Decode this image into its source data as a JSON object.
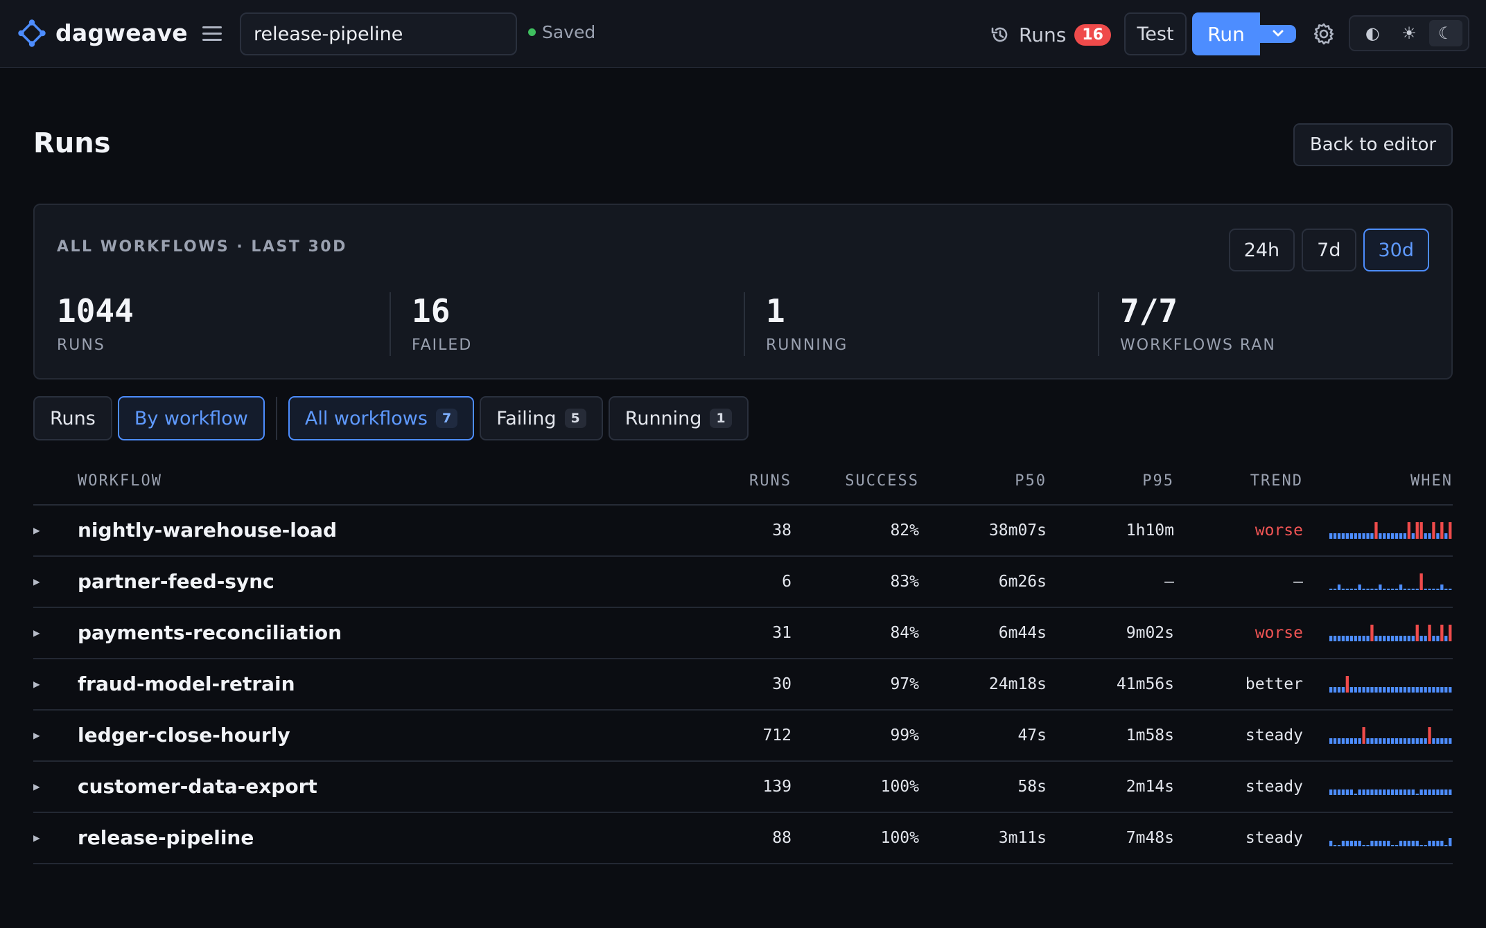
{
  "app": {
    "brand": "dagweave"
  },
  "header": {
    "workflow_name": "release-pipeline",
    "saved_label": "Saved",
    "runs_label": "Runs",
    "runs_count": "16",
    "test_label": "Test",
    "run_label": "Run",
    "theme_icons": [
      "contrast-icon",
      "sun-icon",
      "moon-icon"
    ],
    "theme_symbols": [
      "◐",
      "☀",
      "☾"
    ]
  },
  "page": {
    "title": "Runs",
    "back_label": "Back to editor"
  },
  "summary": {
    "label": "ALL WORKFLOWS · LAST 30D",
    "ranges": [
      "24h",
      "7d",
      "30d"
    ],
    "active_range": "30d",
    "stats": [
      {
        "value": "1044",
        "label": "RUNS"
      },
      {
        "value": "16",
        "label": "FAILED"
      },
      {
        "value": "1",
        "label": "RUNNING"
      },
      {
        "value": "7/7",
        "label": "WORKFLOWS RAN"
      }
    ]
  },
  "view_toggle": {
    "runs": "Runs",
    "by_workflow": "By workflow",
    "active": "by_workflow"
  },
  "filters": [
    {
      "label": "All workflows",
      "count": "7",
      "active": true
    },
    {
      "label": "Failing",
      "count": "5",
      "active": false
    },
    {
      "label": "Running",
      "count": "1",
      "active": false
    }
  ],
  "table": {
    "columns": [
      "WORKFLOW",
      "RUNS",
      "SUCCESS",
      "P50",
      "P95",
      "TREND",
      "WHEN"
    ],
    "rows": [
      {
        "name": "nightly-warehouse-load",
        "runs": "38",
        "success": "82%",
        "p50": "38m07s",
        "p95": "1h10m",
        "trend": "worse",
        "spark": [
          0,
          0,
          0,
          0,
          0,
          0,
          0,
          0,
          0,
          0,
          0,
          1,
          0,
          0,
          0,
          0,
          0,
          0,
          0,
          1,
          0,
          1,
          1,
          0,
          0,
          1,
          0,
          1,
          0,
          1
        ]
      },
      {
        "name": "partner-feed-sync",
        "runs": "6",
        "success": "83%",
        "p50": "6m26s",
        "p95": "–",
        "trend": "–",
        "spark": [
          -1,
          -1,
          0,
          -1,
          -1,
          -1,
          -1,
          0,
          -1,
          -1,
          -1,
          -1,
          0,
          -1,
          -1,
          -1,
          -1,
          0,
          -1,
          -1,
          -1,
          -1,
          1,
          -1,
          -1,
          -1,
          -1,
          0,
          -1,
          -1
        ]
      },
      {
        "name": "payments-reconciliation",
        "runs": "31",
        "success": "84%",
        "p50": "6m44s",
        "p95": "9m02s",
        "trend": "worse",
        "spark": [
          0,
          0,
          0,
          0,
          0,
          0,
          0,
          0,
          0,
          0,
          1,
          0,
          0,
          0,
          0,
          0,
          0,
          0,
          0,
          0,
          0,
          1,
          0,
          0,
          1,
          0,
          0,
          1,
          0,
          1
        ]
      },
      {
        "name": "fraud-model-retrain",
        "runs": "30",
        "success": "97%",
        "p50": "24m18s",
        "p95": "41m56s",
        "trend": "better",
        "spark": [
          0,
          0,
          0,
          0,
          1,
          0,
          0,
          0,
          0,
          0,
          0,
          0,
          0,
          0,
          0,
          0,
          0,
          0,
          0,
          0,
          0,
          0,
          0,
          0,
          0,
          0,
          0,
          0,
          0,
          0
        ]
      },
      {
        "name": "ledger-close-hourly",
        "runs": "712",
        "success": "99%",
        "p50": "47s",
        "p95": "1m58s",
        "trend": "steady",
        "spark": [
          0,
          0,
          0,
          0,
          0,
          0,
          0,
          0,
          1,
          0,
          0,
          0,
          0,
          0,
          0,
          0,
          0,
          0,
          0,
          0,
          0,
          0,
          0,
          0,
          1,
          0,
          0,
          0,
          0,
          0
        ]
      },
      {
        "name": "customer-data-export",
        "runs": "139",
        "success": "100%",
        "p50": "58s",
        "p95": "2m14s",
        "trend": "steady",
        "spark": [
          0,
          0,
          0,
          0,
          0,
          0,
          -1,
          0,
          0,
          0,
          0,
          0,
          0,
          0,
          0,
          0,
          0,
          0,
          0,
          0,
          0,
          -1,
          0,
          0,
          0,
          0,
          0,
          0,
          0,
          0
        ]
      },
      {
        "name": "release-pipeline",
        "runs": "88",
        "success": "100%",
        "p50": "3m11s",
        "p95": "7m48s",
        "trend": "steady",
        "spark": [
          0,
          -1,
          -1,
          0,
          0,
          0,
          0,
          0,
          -1,
          -1,
          0,
          0,
          0,
          0,
          0,
          -1,
          -1,
          0,
          0,
          0,
          0,
          0,
          -1,
          -1,
          0,
          0,
          0,
          0,
          -1,
          2
        ]
      }
    ]
  },
  "colors": {
    "accent": "#4d8dff",
    "fail": "#ef4b4b",
    "success_dot": "#3fbf5f"
  }
}
